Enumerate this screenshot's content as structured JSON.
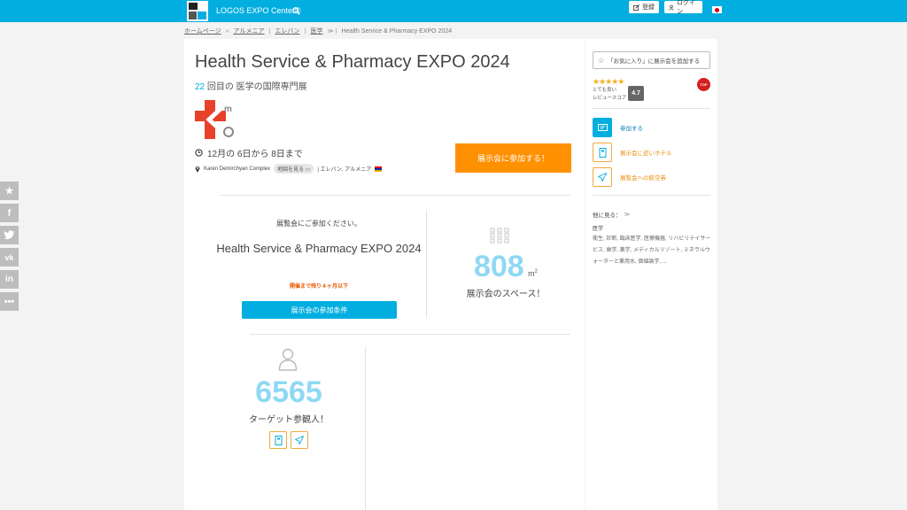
{
  "header": {
    "brand": "LOGOS EXPO Center©",
    "register_label": "登録",
    "login_label": "ログイン"
  },
  "breadcrumb": [
    "ホームページ",
    "アルメニア",
    "エレバン",
    "医学",
    "Health Service & Pharmacy EXPO 2024"
  ],
  "event": {
    "title": "Health Service & Pharmacy EXPO 2024",
    "edition_number": "22",
    "edition_text": "回目の 医学の国際専門展",
    "dates": "12月の 6日から 8日まで",
    "venue": "Karen Demirchyan Complex",
    "map_label": "地図を見る",
    "location": "| エレバン, アルメニア",
    "join_button": "展示会に参加する！"
  },
  "participate": {
    "invite": "展覧会にご参加ください。",
    "expo_name": "Health Service & Pharmacy EXPO 2024",
    "remaining": "開催まで残り４ヶ月以下",
    "conditions_button": "展示会の参加条件"
  },
  "stats": {
    "area_value": "808",
    "area_unit": "m",
    "area_sup": "2",
    "area_label": "展示会のスペース！",
    "visitors_value": "6565",
    "visitors_label": "ターゲット参観人！"
  },
  "sidebar": {
    "favorite_button": "「お気に入り」に展示会を追加する",
    "stars": "★★★★★",
    "rating_text": "とても良い",
    "review_label": "レビュースコア",
    "score": "4.7",
    "actions": [
      "参加する",
      "展示会に近いホテル",
      "展覧会への航空券"
    ],
    "more_label": "他に見る：",
    "category": "医学",
    "related_text": "衛生, 診断, 臨床医学, 医療機器, リハビリテイサービス, 歯学, 薬学, メディカルリゾート, ミネラルウォーターと薬用水, 価値論学, ..."
  },
  "colors": {
    "accent": "#02aee0",
    "orange": "#ff9000",
    "stat": "#8fd8f4"
  },
  "icons": [
    "search-icon",
    "edit-icon",
    "user-icon",
    "clock-icon",
    "pin-icon",
    "star-icon",
    "facebook-icon",
    "twitter-icon",
    "vk-icon",
    "linkedin-icon",
    "more-icon",
    "grid-icon",
    "person-icon",
    "hotel-icon",
    "plane-icon",
    "ticket-icon"
  ]
}
